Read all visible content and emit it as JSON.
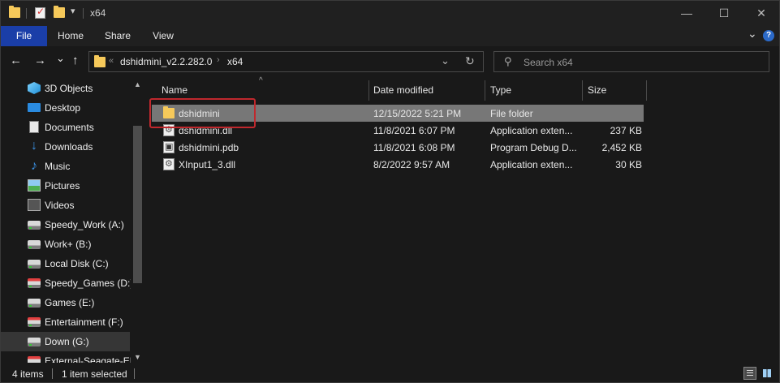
{
  "window": {
    "title": "x64",
    "minimize_glyph": "—",
    "maximize_glyph": "☐",
    "close_glyph": "✕"
  },
  "quick_access": {
    "dropdown_glyph": "▾"
  },
  "ribbon": {
    "tabs": [
      "File",
      "Home",
      "Share",
      "View"
    ],
    "expand_glyph": "⌄",
    "help_glyph": "?"
  },
  "nav": {
    "back_glyph": "←",
    "forward_glyph": "→",
    "recent_glyph": "⌄",
    "up_glyph": "↑"
  },
  "address": {
    "overflow_glyph": "«",
    "crumbs": [
      "dshidmini_v2.2.282.0",
      "x64"
    ],
    "separator_glyph": "›",
    "dropdown_glyph": "⌄",
    "refresh_glyph": "↻"
  },
  "search": {
    "placeholder": "Search x64",
    "icon": "search-icon",
    "icon_glyph": "⚲"
  },
  "navpane": {
    "items": [
      {
        "label": "3D Objects",
        "icon": "3d-objects-icon"
      },
      {
        "label": "Desktop",
        "icon": "desktop-icon"
      },
      {
        "label": "Documents",
        "icon": "documents-icon"
      },
      {
        "label": "Downloads",
        "icon": "downloads-icon"
      },
      {
        "label": "Music",
        "icon": "music-icon"
      },
      {
        "label": "Pictures",
        "icon": "pictures-icon"
      },
      {
        "label": "Videos",
        "icon": "videos-icon"
      },
      {
        "label": "Speedy_Work (A:)",
        "icon": "drive-icon"
      },
      {
        "label": "Work+ (B:)",
        "icon": "drive-icon"
      },
      {
        "label": "Local Disk (C:)",
        "icon": "drive-icon"
      },
      {
        "label": "Speedy_Games (D:)",
        "icon": "drive-icon"
      },
      {
        "label": "Games (E:)",
        "icon": "drive-icon"
      },
      {
        "label": "Entertainment (F:)",
        "icon": "drive-icon"
      },
      {
        "label": "Down (G:)",
        "icon": "drive-icon",
        "selected": true
      },
      {
        "label": "External-Seagate-EN",
        "icon": "drive-icon"
      }
    ],
    "scroll_up_glyph": "▲",
    "scroll_down_glyph": "▼"
  },
  "filelist": {
    "columns": [
      "Name",
      "Date modified",
      "Type",
      "Size"
    ],
    "sort_glyph": "^",
    "rows": [
      {
        "name": "dshidmini",
        "date": "12/15/2022 5:21 PM",
        "type": "File folder",
        "size": "",
        "icon": "folder-icon",
        "selected": true
      },
      {
        "name": "dshidmini.dll",
        "date": "11/8/2021 6:07 PM",
        "type": "Application exten...",
        "size": "237 KB",
        "icon": "dll-file-icon"
      },
      {
        "name": "dshidmini.pdb",
        "date": "11/8/2021 6:08 PM",
        "type": "Program Debug D...",
        "size": "2,452 KB",
        "icon": "pdb-file-icon"
      },
      {
        "name": "XInput1_3.dll",
        "date": "8/2/2022 9:57 AM",
        "type": "Application exten...",
        "size": "30 KB",
        "icon": "dll-file-icon"
      }
    ]
  },
  "status": {
    "item_count": "4 items",
    "selection": "1 item selected"
  },
  "colors": {
    "accent_file_tab": "#1a3ea8",
    "highlight_box": "#c0282d",
    "selected_row": "#777777",
    "background": "#191919"
  }
}
